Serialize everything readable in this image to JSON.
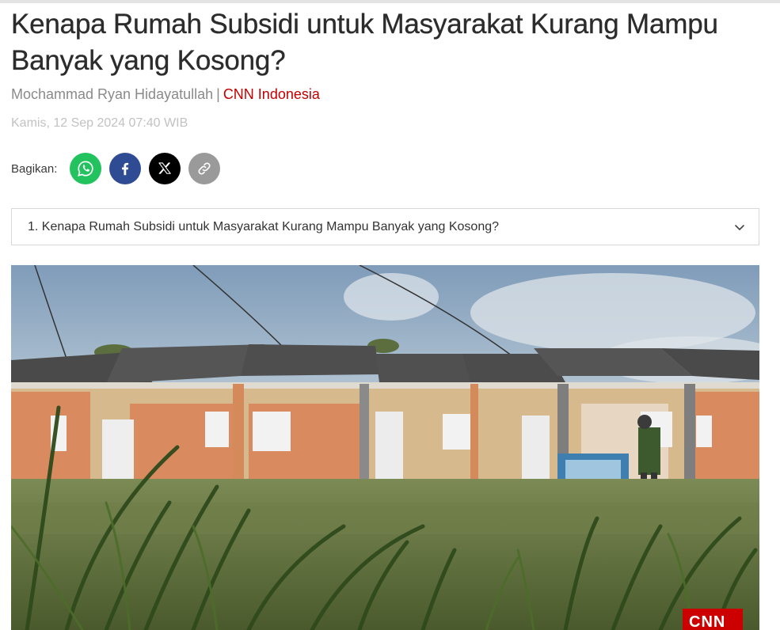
{
  "article": {
    "title": "Kenapa Rumah Subsidi untuk Masyarakat Kurang Mampu Banyak yang Kosong?",
    "author": "Mochammad Ryan Hidayatullah",
    "separator": "|",
    "source": "CNN Indonesia",
    "date": "Kamis, 12 Sep 2024 07:40 WIB"
  },
  "share": {
    "label": "Bagikan:",
    "buttons": [
      {
        "icon": "whatsapp-icon",
        "color": "#22c35e"
      },
      {
        "icon": "facebook-icon",
        "color": "#2f4b93"
      },
      {
        "icon": "x-icon",
        "color": "#000000"
      },
      {
        "icon": "link-icon",
        "color": "#9a9a9a"
      }
    ]
  },
  "toc": {
    "item": "1. Kenapa Rumah Subsidi untuk Masyarakat Kurang Mampu Banyak yang Kosong?"
  },
  "hero": {
    "watermark": "CNN",
    "watermark_color": "#cc0000"
  },
  "colors": {
    "title": "#2c2c2c",
    "byline": "#8a8a8a",
    "source": "#c30000",
    "date": "#c2c2c2"
  }
}
